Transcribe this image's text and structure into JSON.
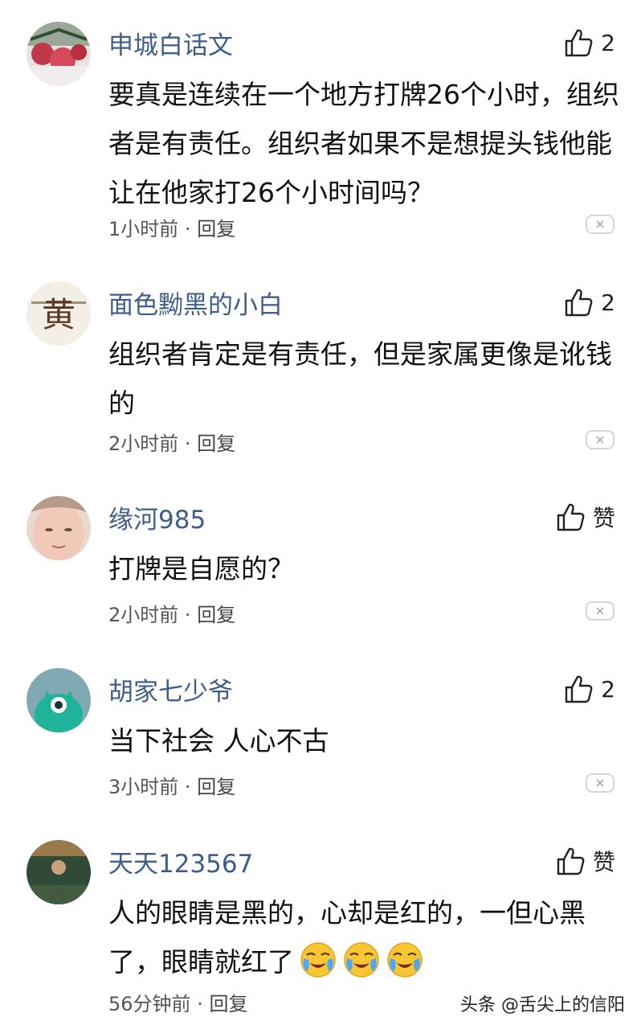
{
  "comments": [
    {
      "username": "申城白话文",
      "likes": "2",
      "text": "要真是连续在一个地方打牌26个小时，组织者是有责任。组织者如果不是想提头钱他能让在他家打26个小时间吗？",
      "time": "1小时前",
      "reply_label": "回复"
    },
    {
      "username": "面色黝黑的小白",
      "likes": "2",
      "text": "组织者肯定是有责任，但是家属更像是讹钱的",
      "time": "2小时前",
      "reply_label": "回复",
      "avatar_char": "黄"
    },
    {
      "username": "缘河985",
      "likes": "赞",
      "text": "打牌是自愿的？",
      "time": "2小时前",
      "reply_label": "回复"
    },
    {
      "username": "胡家七少爷",
      "likes": "2",
      "text": "当下社会 人心不古",
      "time": "3小时前",
      "reply_label": "回复"
    },
    {
      "username": "天天123567",
      "likes": "赞",
      "text": "人的眼睛是黑的，心却是红的，一但心黑了，眼睛就红了",
      "time": "56分钟前",
      "reply_label": "回复",
      "emojis": [
        "crying-face",
        "crying-face",
        "crying-face"
      ]
    }
  ],
  "meta_separator": "·",
  "watermark": "头条 @舌尖上的信阳",
  "icons": {
    "like": "thumbs-up-icon",
    "dismiss": "close-icon"
  },
  "colors": {
    "username": "#3f5d8a",
    "text": "#111111",
    "meta": "#555555"
  }
}
